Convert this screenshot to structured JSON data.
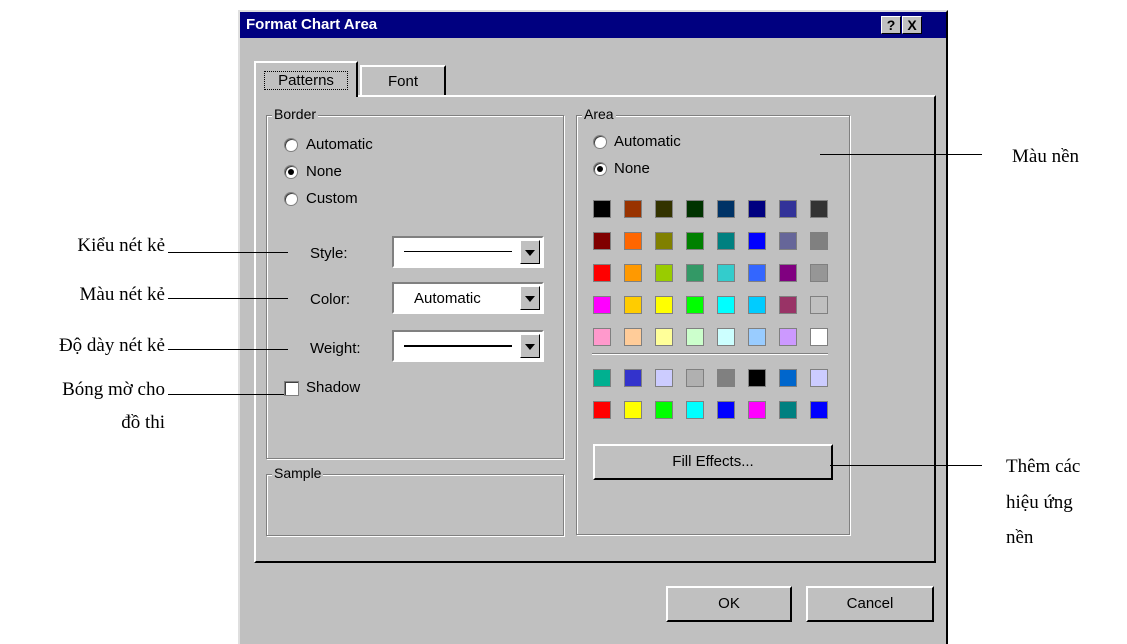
{
  "dialog": {
    "title": "Format Chart Area",
    "help_icon": "?",
    "close_icon": "X",
    "tabs": [
      {
        "label": "Patterns"
      },
      {
        "label": "Font"
      }
    ]
  },
  "border": {
    "legend": "Border",
    "options": [
      "Automatic",
      "None",
      "Custom"
    ],
    "selected": "None",
    "style_label": "Style:",
    "color_label": "Color:",
    "color_value": "Automatic",
    "weight_label": "Weight:",
    "shadow_label": "Shadow"
  },
  "sample": {
    "legend": "Sample"
  },
  "area": {
    "legend": "Area",
    "options": [
      "Automatic",
      "None"
    ],
    "selected": "None",
    "palette_top": [
      [
        "#000000",
        "#993300",
        "#333300",
        "#003300",
        "#003366",
        "#000080",
        "#333399",
        "#333333"
      ],
      [
        "#800000",
        "#FF6600",
        "#808000",
        "#008000",
        "#008080",
        "#0000FF",
        "#666699",
        "#808080"
      ],
      [
        "#FF0000",
        "#FF9900",
        "#99CC00",
        "#339966",
        "#33CCCC",
        "#3366FF",
        "#800080",
        "#969696"
      ],
      [
        "#FF00FF",
        "#FFCC00",
        "#FFFF00",
        "#00FF00",
        "#00FFFF",
        "#00CCFF",
        "#993366",
        "#C0C0C0"
      ],
      [
        "#FF99CC",
        "#FFCC99",
        "#FFFF99",
        "#CCFFCC",
        "#CCFFFF",
        "#99CCFF",
        "#CC99FF",
        "#FFFFFF"
      ]
    ],
    "palette_bottom": [
      [
        "#00B090",
        "#3333CC",
        "#CCCCFF",
        "#B0B0B0",
        "#808080",
        "#000000",
        "#0066CC",
        "#CCCCFF"
      ],
      [
        "#FF0000",
        "#FFFF00",
        "#00FF00",
        "#00FFFF",
        "#0000FF",
        "#FF00FF",
        "#008080",
        "#0000FF"
      ]
    ],
    "fill_effects_label": "Fill Effects..."
  },
  "buttons": {
    "ok": "OK",
    "cancel": "Cancel"
  },
  "annotations": {
    "line_style": "Kiểu nét kẻ",
    "line_color": "Màu nét kẻ",
    "line_weight": "Độ dày nét kẻ",
    "shadow_1": "Bóng mờ cho",
    "shadow_2": "đồ thi",
    "bg_color": "Màu nền",
    "effects_1": "Thêm các",
    "effects_2": "hiệu ứng",
    "effects_3": "nền"
  }
}
